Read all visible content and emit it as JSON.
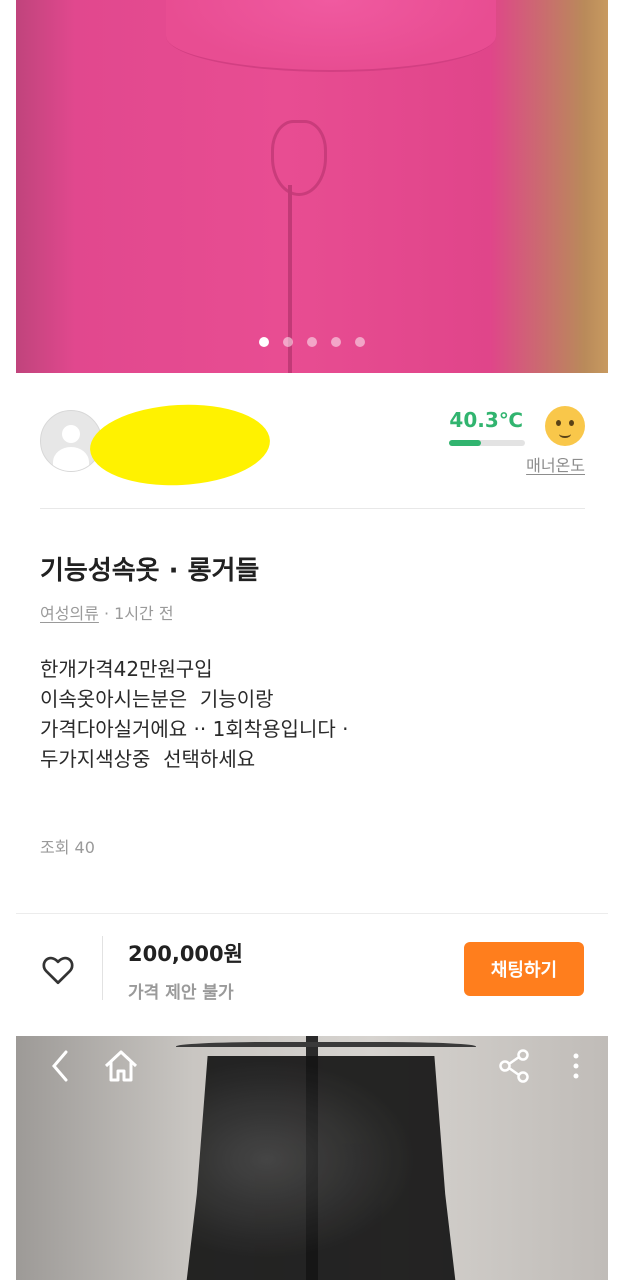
{
  "gallery": {
    "dot_count": 5,
    "active_index": 0
  },
  "seller": {
    "temperature": "40.3℃",
    "temperature_fill": 0.42,
    "manner_label": "매너온도"
  },
  "product": {
    "title": "기능성속옷 · 롱거들",
    "category": "여성의류",
    "time": " · 1시간 전",
    "description": "한개가격42만원구입\n이속옷아시는분은  기능이랑\n가격다아실거에요 ·· 1회착용입니다 ·\n두가지색상중  선택하세요",
    "views": "조회 40"
  },
  "footer": {
    "price": "200,000원",
    "negotiation": "가격 제안 불가",
    "chat_button": "채팅하기"
  },
  "colors": {
    "accent": "#ff7e1d",
    "temperature": "#31b46f",
    "redaction": "#fff200"
  },
  "icons": [
    "heart-icon",
    "back-arrow-icon",
    "home-icon",
    "share-icon",
    "more-icon"
  ]
}
